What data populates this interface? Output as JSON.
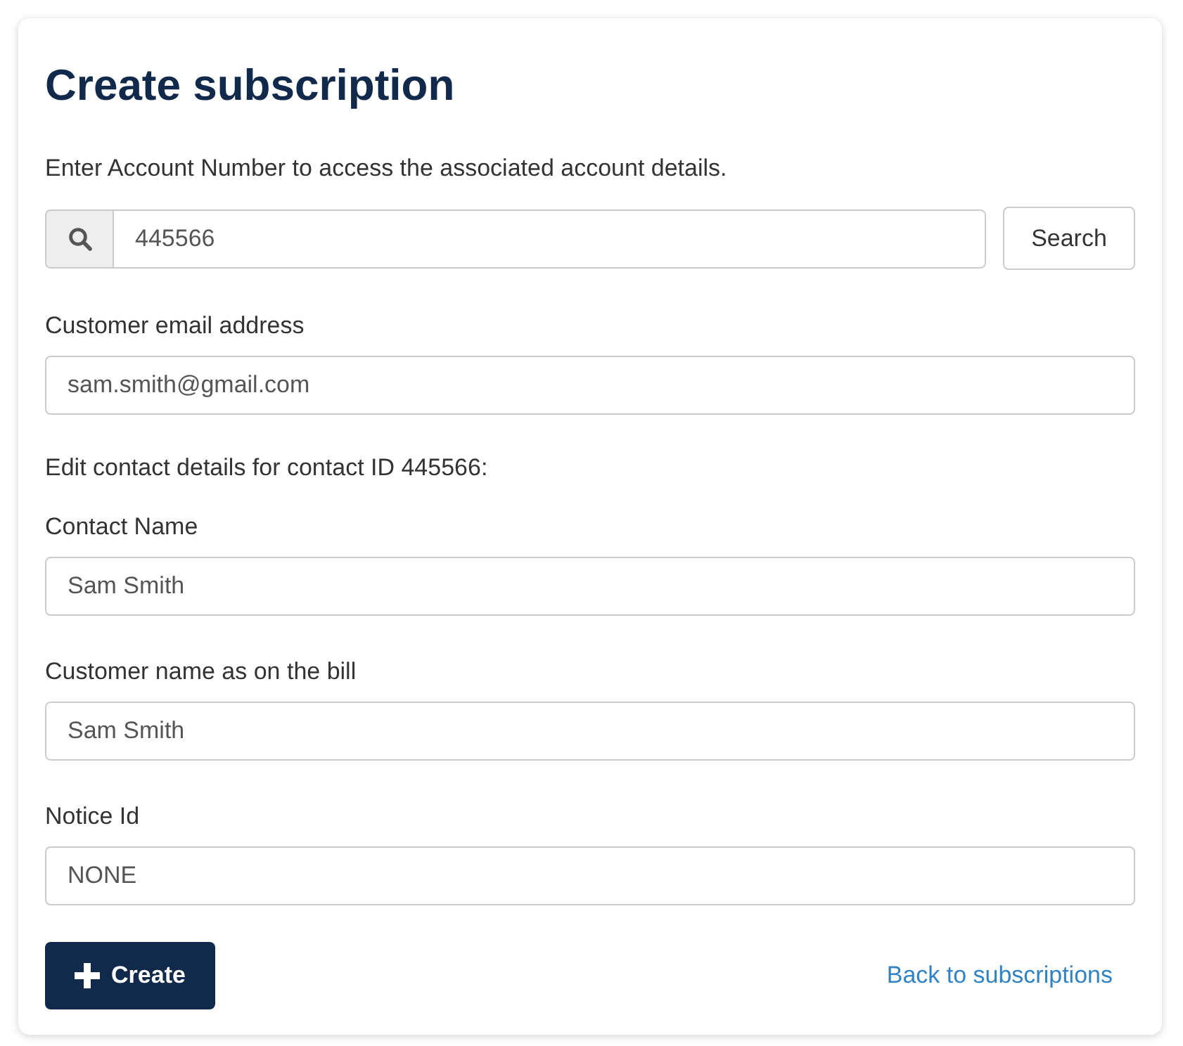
{
  "title": "Create subscription",
  "intro": "Enter Account Number to access the associated account details.",
  "search": {
    "value": "445566",
    "button": "Search"
  },
  "items": [
    {
      "kind": "field",
      "label": "Customer email address",
      "value": "sam.smith@gmail.com"
    },
    {
      "kind": "note",
      "text": "Edit contact details for contact ID 445566:"
    },
    {
      "kind": "field",
      "label": "Contact Name",
      "value": "Sam Smith"
    },
    {
      "kind": "field",
      "label": "Customer name as on the bill",
      "value": "Sam Smith"
    },
    {
      "kind": "field",
      "label": "Notice Id",
      "value": "NONE"
    }
  ],
  "actions": {
    "create": "Create",
    "back_link": "Back to subscriptions"
  }
}
